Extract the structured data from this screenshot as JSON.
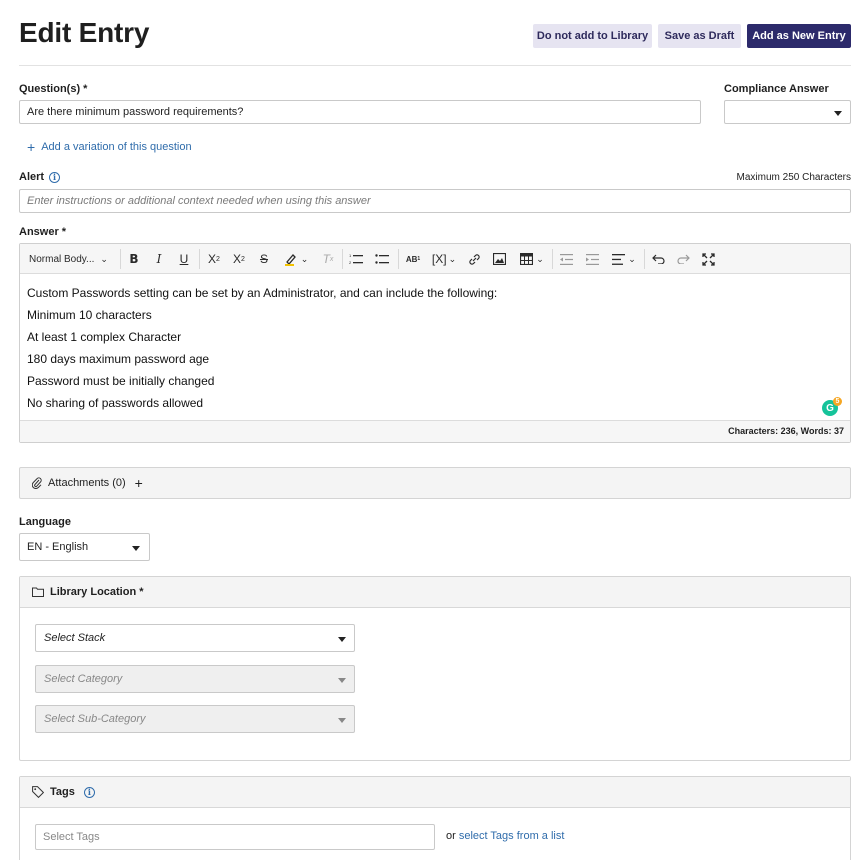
{
  "header": {
    "title": "Edit Entry",
    "btn_no_library": "Do not add to Library",
    "btn_save_draft": "Save as Draft",
    "btn_add_new": "Add as New Entry"
  },
  "question": {
    "label": "Question(s) *",
    "value": "Are there minimum password requirements?",
    "add_variation": "Add a variation of this question"
  },
  "compliance": {
    "label": "Compliance Answer",
    "value": ""
  },
  "alert": {
    "label": "Alert",
    "max_chars": "Maximum 250 Characters",
    "placeholder": "Enter instructions or additional context needed when using this answer"
  },
  "answer": {
    "label": "Answer *",
    "style_select": "Normal Body...",
    "lines": [
      "Custom Passwords setting can be set by an Administrator, and can include the following:",
      "Minimum 10 characters",
      "At least 1 complex Character",
      "180 days maximum password age",
      "Password must be initially changed",
      "No sharing of passwords allowed"
    ],
    "stats": "Characters: 236, Words: 37",
    "grammarly_count": "5"
  },
  "attachments": {
    "label": "Attachments (0)"
  },
  "language": {
    "label": "Language",
    "value": "EN - English"
  },
  "library": {
    "label": "Library Location *",
    "stack_placeholder": "Select Stack",
    "category_placeholder": "Select Category",
    "subcategory_placeholder": "Select Sub-Category"
  },
  "tags": {
    "label": "Tags",
    "placeholder": "Select Tags",
    "or_text": "or",
    "list_link": "select Tags from a list"
  }
}
